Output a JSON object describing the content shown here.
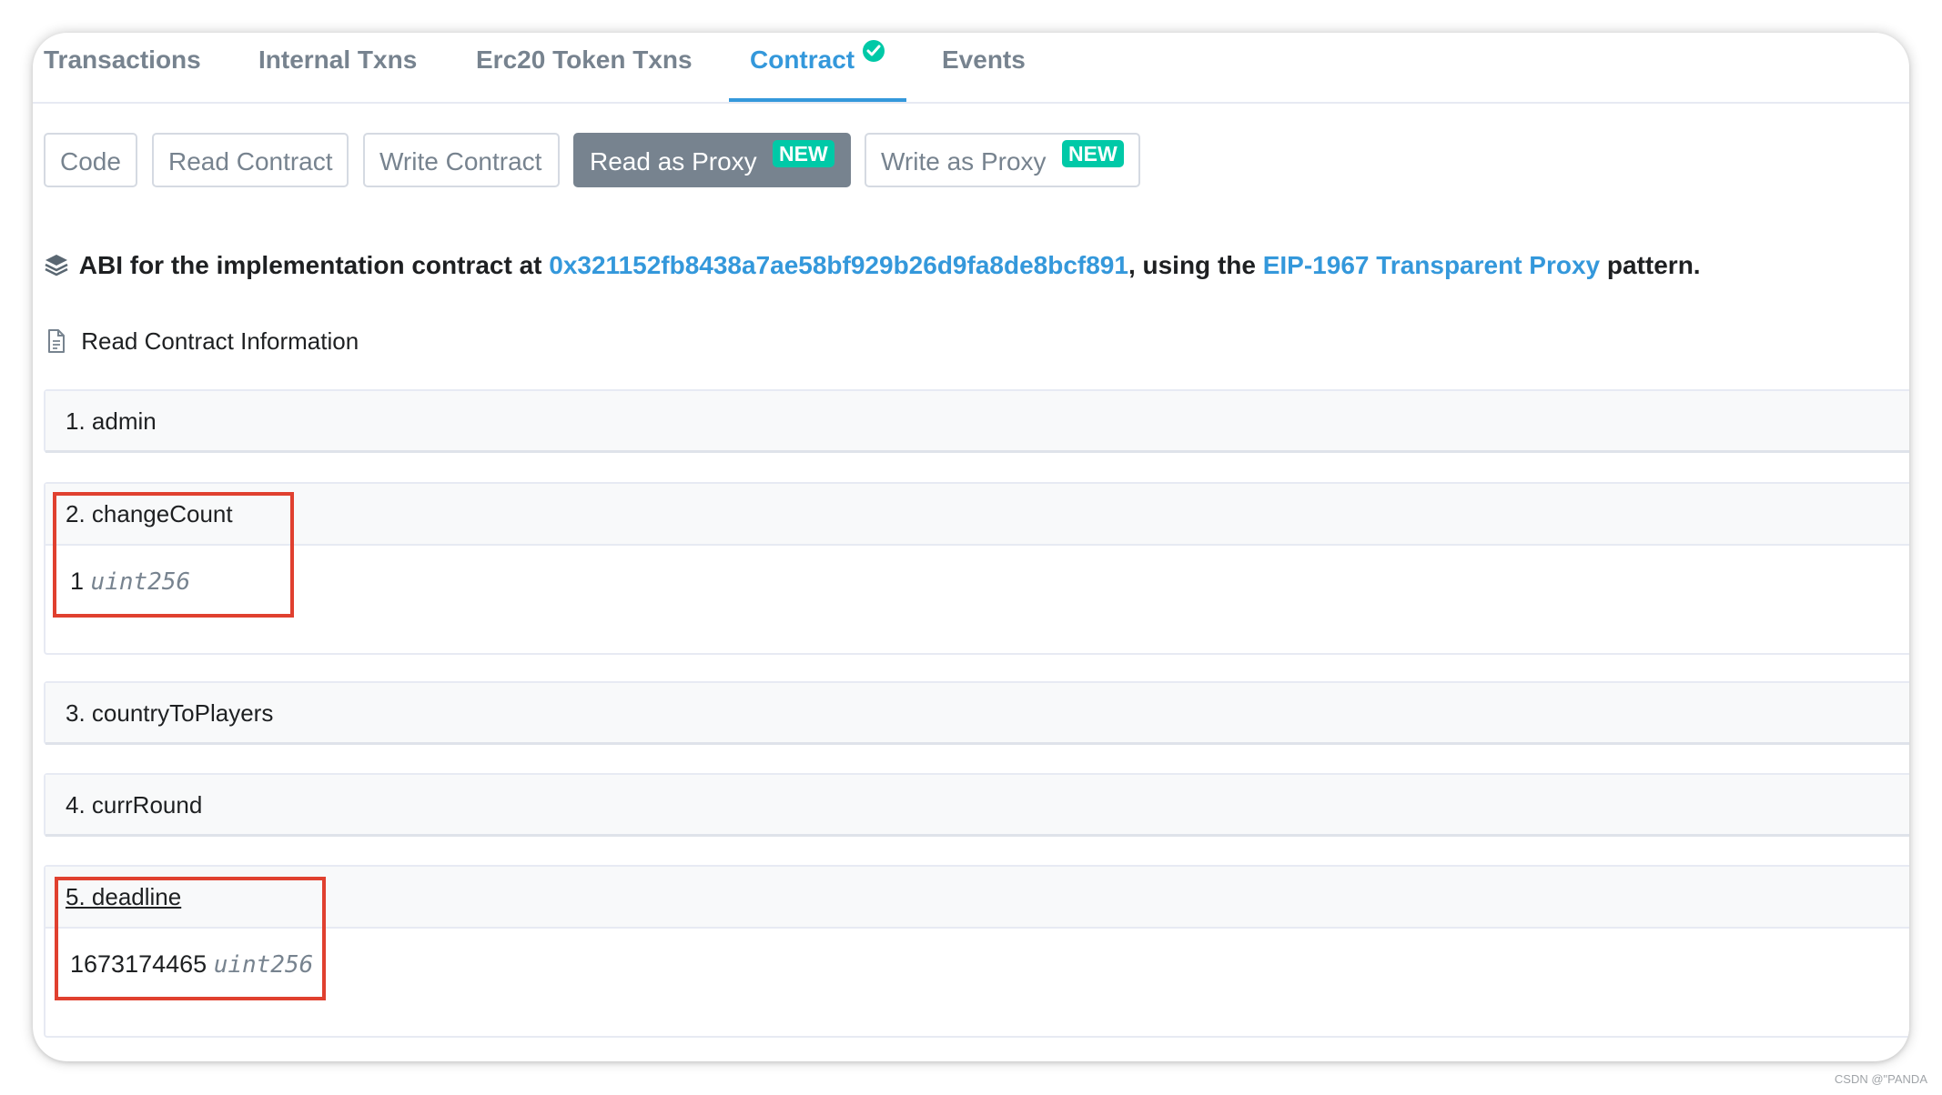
{
  "tabs": [
    {
      "label": "Transactions"
    },
    {
      "label": "Internal Txns"
    },
    {
      "label": "Erc20 Token Txns"
    },
    {
      "label": "Contract"
    },
    {
      "label": "Events"
    }
  ],
  "subnav": {
    "code": "Code",
    "read_contract": "Read Contract",
    "write_contract": "Write Contract",
    "read_as_proxy": "Read as Proxy",
    "write_as_proxy": "Write as Proxy",
    "new_badge": "NEW"
  },
  "abi": {
    "prefix": "ABI for the implementation contract at",
    "address": "0x321152fb8438a7ae58bf929b26d9fa8de8bcf891",
    "middle": ", using the",
    "proxy_link": "EIP-1967 Transparent Proxy",
    "suffix": "pattern."
  },
  "section_title": "Read Contract Information",
  "functions": [
    {
      "label": "1. admin"
    },
    {
      "label": "2. changeCount",
      "value": "1",
      "type": "uint256"
    },
    {
      "label": "3. countryToPlayers"
    },
    {
      "label": "4. currRound"
    },
    {
      "label": "5. deadline",
      "value": "1673174465",
      "type": "uint256"
    }
  ],
  "colors": {
    "accent": "#3498db",
    "badge": "#00c9a7",
    "highlight": "#e0402f"
  },
  "watermark": "CSDN @\"PANDA"
}
